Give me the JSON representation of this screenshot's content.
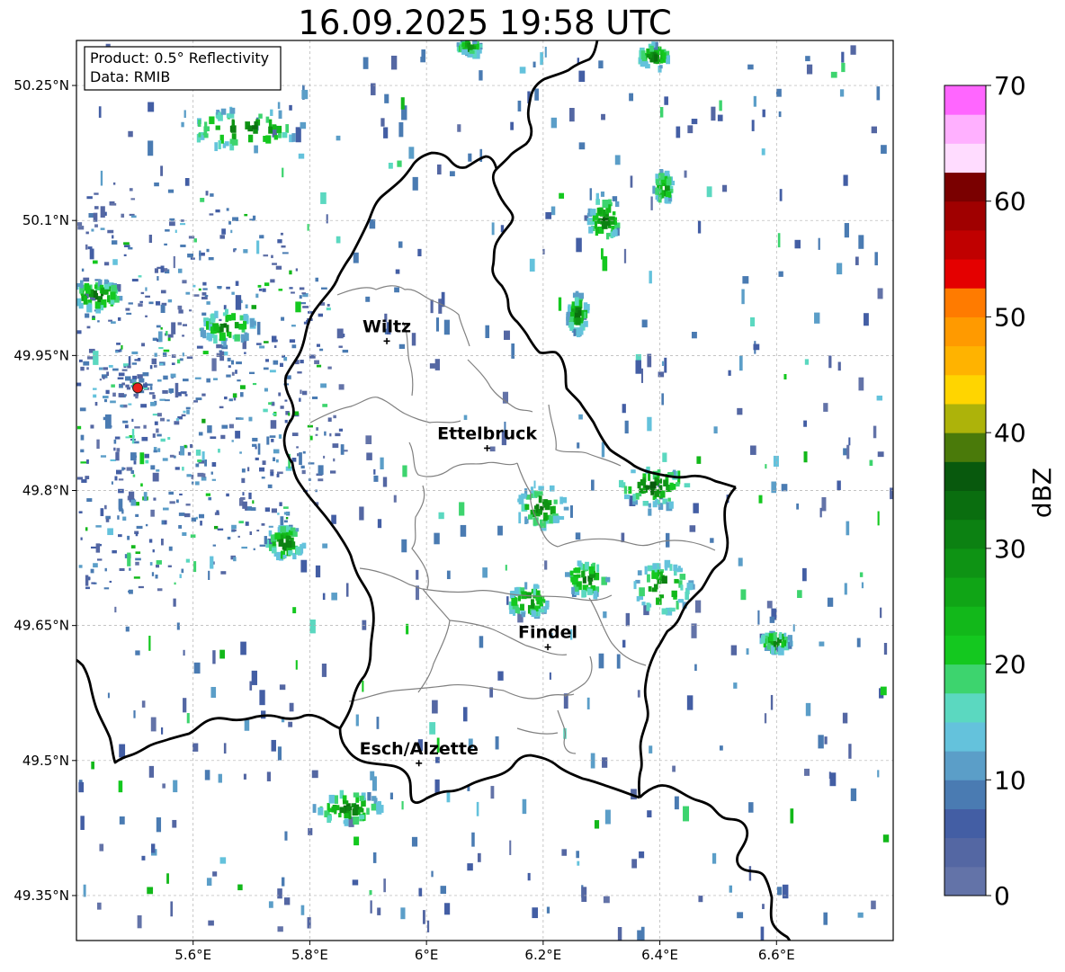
{
  "title": "16.09.2025 19:58 UTC",
  "info_box": {
    "product": "Product: 0.5° Reflectivity",
    "data_source": "Data: RMIB"
  },
  "map": {
    "lon_range": [
      5.4,
      6.8
    ],
    "lat_range": [
      49.3,
      50.3
    ],
    "x_ticks": [
      {
        "value": 5.6,
        "label": "5.6°E"
      },
      {
        "value": 5.8,
        "label": "5.8°E"
      },
      {
        "value": 6.0,
        "label": "6°E"
      },
      {
        "value": 6.2,
        "label": "6.2°E"
      },
      {
        "value": 6.4,
        "label": "6.4°E"
      },
      {
        "value": 6.6,
        "label": "6.6°E"
      }
    ],
    "y_ticks": [
      {
        "value": 50.25,
        "label": "50.25°N"
      },
      {
        "value": 50.1,
        "label": "50.1°N"
      },
      {
        "value": 49.95,
        "label": "49.95°N"
      },
      {
        "value": 49.8,
        "label": "49.8°N"
      },
      {
        "value": 49.65,
        "label": "49.65°N"
      },
      {
        "value": 49.5,
        "label": "49.5°N"
      },
      {
        "value": 49.35,
        "label": "49.35°N"
      }
    ],
    "grid": true,
    "radar_site": {
      "lon": 5.505,
      "lat": 49.914,
      "color": "#e8201a"
    },
    "cities": [
      {
        "name": "Wiltz",
        "lon": 5.932,
        "lat": 49.966
      },
      {
        "name": "Ettelbruck",
        "lon": 6.104,
        "lat": 49.847
      },
      {
        "name": "Findel",
        "lon": 6.208,
        "lat": 49.626
      },
      {
        "name": "Esch/Alzette",
        "lon": 5.987,
        "lat": 49.497
      }
    ]
  },
  "colorbar": {
    "label": "dBZ",
    "min": 0,
    "max": 70,
    "ticks": [
      {
        "value": 0,
        "label": "0"
      },
      {
        "value": 10,
        "label": "10"
      },
      {
        "value": 20,
        "label": "20"
      },
      {
        "value": 30,
        "label": "30"
      },
      {
        "value": 40,
        "label": "40"
      },
      {
        "value": 50,
        "label": "50"
      },
      {
        "value": 60,
        "label": "60"
      },
      {
        "value": 70,
        "label": "70"
      }
    ],
    "bins": [
      {
        "from": 0,
        "to": 2.5,
        "color": "#6373a8"
      },
      {
        "from": 2.5,
        "to": 5,
        "color": "#5467a3"
      },
      {
        "from": 5,
        "to": 7.5,
        "color": "#435ea4"
      },
      {
        "from": 7.5,
        "to": 10,
        "color": "#4a7bb2"
      },
      {
        "from": 10,
        "to": 12.5,
        "color": "#5b9ec8"
      },
      {
        "from": 12.5,
        "to": 15,
        "color": "#64c2dc"
      },
      {
        "from": 15,
        "to": 17.5,
        "color": "#5bd8c0"
      },
      {
        "from": 17.5,
        "to": 20,
        "color": "#3dd46e"
      },
      {
        "from": 20,
        "to": 22.5,
        "color": "#14c81f"
      },
      {
        "from": 22.5,
        "to": 25,
        "color": "#12b81a"
      },
      {
        "from": 25,
        "to": 27.5,
        "color": "#10a516"
      },
      {
        "from": 27.5,
        "to": 30,
        "color": "#0e9314"
      },
      {
        "from": 30,
        "to": 32.5,
        "color": "#0c8112"
      },
      {
        "from": 32.5,
        "to": 35,
        "color": "#0a6e0f"
      },
      {
        "from": 35,
        "to": 37.5,
        "color": "#08590d"
      },
      {
        "from": 37.5,
        "to": 40,
        "color": "#4a7a0a"
      },
      {
        "from": 40,
        "to": 42.5,
        "color": "#adb30a"
      },
      {
        "from": 42.5,
        "to": 45,
        "color": "#ffd500"
      },
      {
        "from": 45,
        "to": 47.5,
        "color": "#ffb300"
      },
      {
        "from": 47.5,
        "to": 50,
        "color": "#ff9a00"
      },
      {
        "from": 50,
        "to": 52.5,
        "color": "#ff7b00"
      },
      {
        "from": 52.5,
        "to": 55,
        "color": "#e40000"
      },
      {
        "from": 55,
        "to": 57.5,
        "color": "#c00000"
      },
      {
        "from": 57.5,
        "to": 60,
        "color": "#a00000"
      },
      {
        "from": 60,
        "to": 62.5,
        "color": "#7a0000"
      },
      {
        "from": 62.5,
        "to": 65,
        "color": "#ffdcff"
      },
      {
        "from": 65,
        "to": 67.5,
        "color": "#ffb0ff"
      },
      {
        "from": 67.5,
        "to": 70,
        "color": "#ff66ff"
      },
      {
        "from": 70,
        "to": 72.5,
        "color": "#e83ae8"
      }
    ]
  },
  "colors": {
    "border": "#000000",
    "canton_border": "#808080",
    "grid": "#b0b0b0"
  }
}
